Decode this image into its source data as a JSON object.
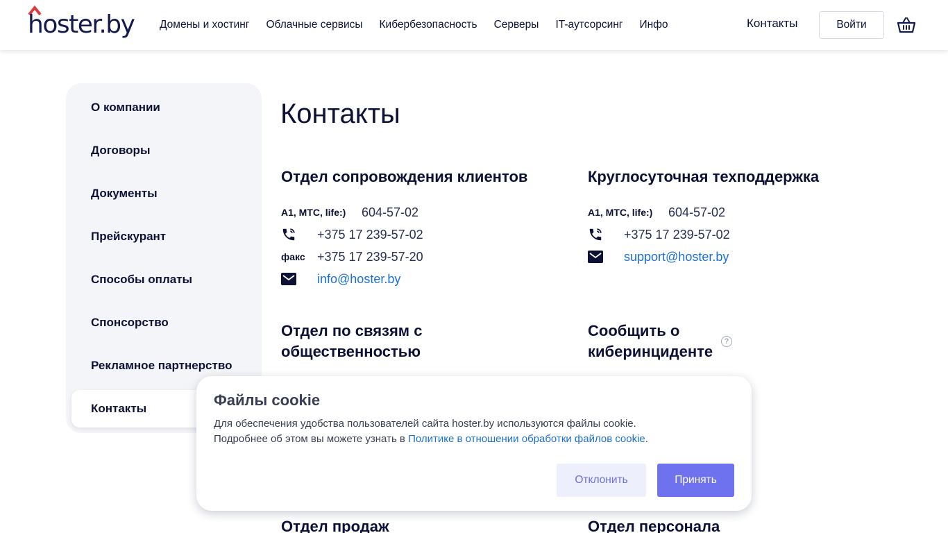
{
  "brand": {
    "logo_text": "hoster.by",
    "accent": "#e03a3a",
    "primary": "#141a4e",
    "link": "#1a6fd6"
  },
  "nav": {
    "items": [
      {
        "label": "Домены и хостинг"
      },
      {
        "label": "Облачные сервисы"
      },
      {
        "label": "Кибербезопасность"
      },
      {
        "label": "Серверы"
      },
      {
        "label": "IT-аутсорсинг"
      },
      {
        "label": "Инфо"
      }
    ],
    "contacts": "Контакты",
    "login": "Войти",
    "cart_icon": "basket-icon"
  },
  "sidebar": {
    "items": [
      {
        "label": "О компании"
      },
      {
        "label": "Договоры"
      },
      {
        "label": "Документы"
      },
      {
        "label": "Прейскурант"
      },
      {
        "label": "Способы оплаты"
      },
      {
        "label": "Спонсорство"
      },
      {
        "label": "Рекламное партнерство"
      },
      {
        "label": "Контакты",
        "active": true
      }
    ]
  },
  "main": {
    "title": "Контакты",
    "client_support": {
      "heading": "Отдел сопровождения клиентов",
      "mobile_label": "A1, МТС, life:)",
      "mobile": "604-57-02",
      "phone": "+375 17 239-57-02",
      "fax_label": "факс",
      "fax": "+375 17 239-57-20",
      "email": "info@hoster.by"
    },
    "tech_support": {
      "heading": "Круглосуточная техподдержка",
      "mobile_label": "A1, МТС, life:)",
      "mobile": "604-57-02",
      "phone": "+375 17 239-57-02",
      "email": "support@hoster.by"
    },
    "pr": {
      "heading_line1": "Отдел по связям с",
      "heading_line2": "общественностью"
    },
    "incident": {
      "heading_line1": "Сообщить о",
      "heading_line2": "киберинциденте",
      "help": "?"
    },
    "sales": {
      "heading": "Отдел продаж"
    },
    "hr": {
      "heading": "Отдел персонала"
    }
  },
  "cookie": {
    "title": "Файлы cookie",
    "text_line1": "Для обеспечения удобства пользователей сайта hoster.by используются файлы cookie.",
    "text_line2_prefix": "Подробнее об этом вы можете узнать в ",
    "text_link": "Политике в отношении обработки файлов cookie",
    "text_suffix": ".",
    "decline": "Отклонить",
    "accept": "Принять"
  }
}
